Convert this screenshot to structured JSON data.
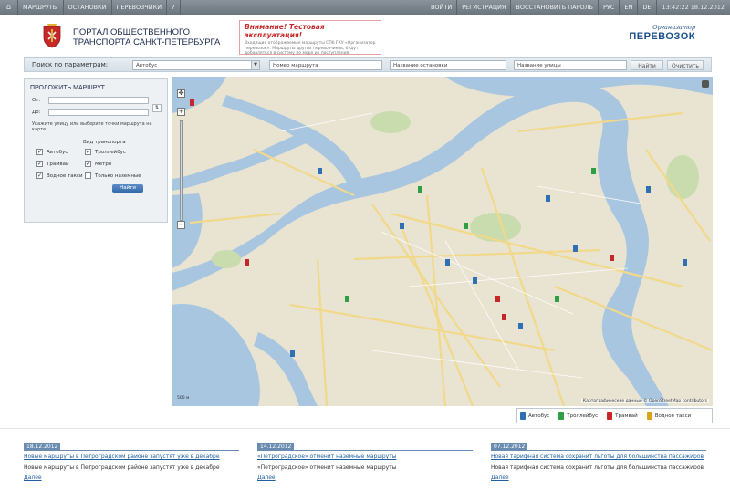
{
  "topnav": {
    "home_icon": "home-icon",
    "items": [
      "МАРШРУТЫ",
      "ОСТАНОВКИ",
      "ПЕРЕВОЗЧИКИ"
    ],
    "extra": "?",
    "right_items": [
      "ВОЙТИ",
      "РЕГИСТРАЦИЯ",
      "ВОССТАНОВИТЬ ПАРОЛЬ",
      "РУС",
      "EN",
      "DE"
    ],
    "datetime": "13:42:22 18.12.2012"
  },
  "header": {
    "portal_title": "ПОРТАЛ ОБЩЕСТВЕННОГО ТРАНСПОРТА САНКТ-ПЕТЕРБУРГА",
    "notice_title": "Внимание! Тестовая эксплуатация!",
    "notice_text": "Входящие отображаемые маршруты СПб ГКУ «Организатор перевозок». Маршруты других перевозчиков, будут добавляться в систему по мере их поступления.",
    "logo_top": "Организатор",
    "logo_main": "ПЕРЕВОЗОК"
  },
  "search": {
    "label": "Поиск по параметрам:",
    "type_value": "Автобус",
    "route_placeholder": "Номер маршрута",
    "stop_placeholder": "Название остановки",
    "street_placeholder": "Название улицы",
    "find_label": "Найти",
    "clear_label": "Очистить"
  },
  "route_panel": {
    "title": "ПРОЛОЖИТЬ МАРШРУТ",
    "from_label": "От:",
    "to_label": "До:",
    "note": "Укажите улицу или выберите точки маршрута на карте",
    "transport_header": "Вид транспорта",
    "options": [
      "Автобус",
      "Троллейбус",
      "Трамвай",
      "Метро",
      "Водное такси",
      "Только наземные"
    ],
    "checked": [
      true,
      true,
      true,
      true,
      true,
      false
    ],
    "find_label": "Найти"
  },
  "map": {
    "copyright": "Картографические данные © OpenStreetMap contributors",
    "scale": "500 м"
  },
  "legend": [
    {
      "label": "Автобус",
      "color": "#2f6fb3"
    },
    {
      "label": "Троллейбус",
      "color": "#2ea043"
    },
    {
      "label": "Трамвай",
      "color": "#c62828"
    },
    {
      "label": "Водное такси",
      "color": "#d9a21b"
    }
  ],
  "news": [
    {
      "date": "18.12.2012",
      "headline": "Новые маршруты в Петроградском районе запустят уже в декабре",
      "text": "Новые маршруты в Петроградском районе запустят уже в декабре",
      "more": "Далее"
    },
    {
      "date": "14.12.2012",
      "headline": "«Петроградское» отменит наземные маршруты",
      "text": "«Петроградское» отменит наземные маршруты",
      "more": "Далее"
    },
    {
      "date": "07.12.2012",
      "headline": "Новая тарифная система сохранит льготы для большинства пассажиров",
      "text": "Новая тарифная система сохранит льготы для большинства пассажиров",
      "more": "Далее"
    }
  ],
  "colors": {
    "nav": "#7a838b",
    "water": "#a9c6e0",
    "land": "#ece7d8",
    "road": "#f1d98a",
    "accent": "#1f5fa0"
  }
}
